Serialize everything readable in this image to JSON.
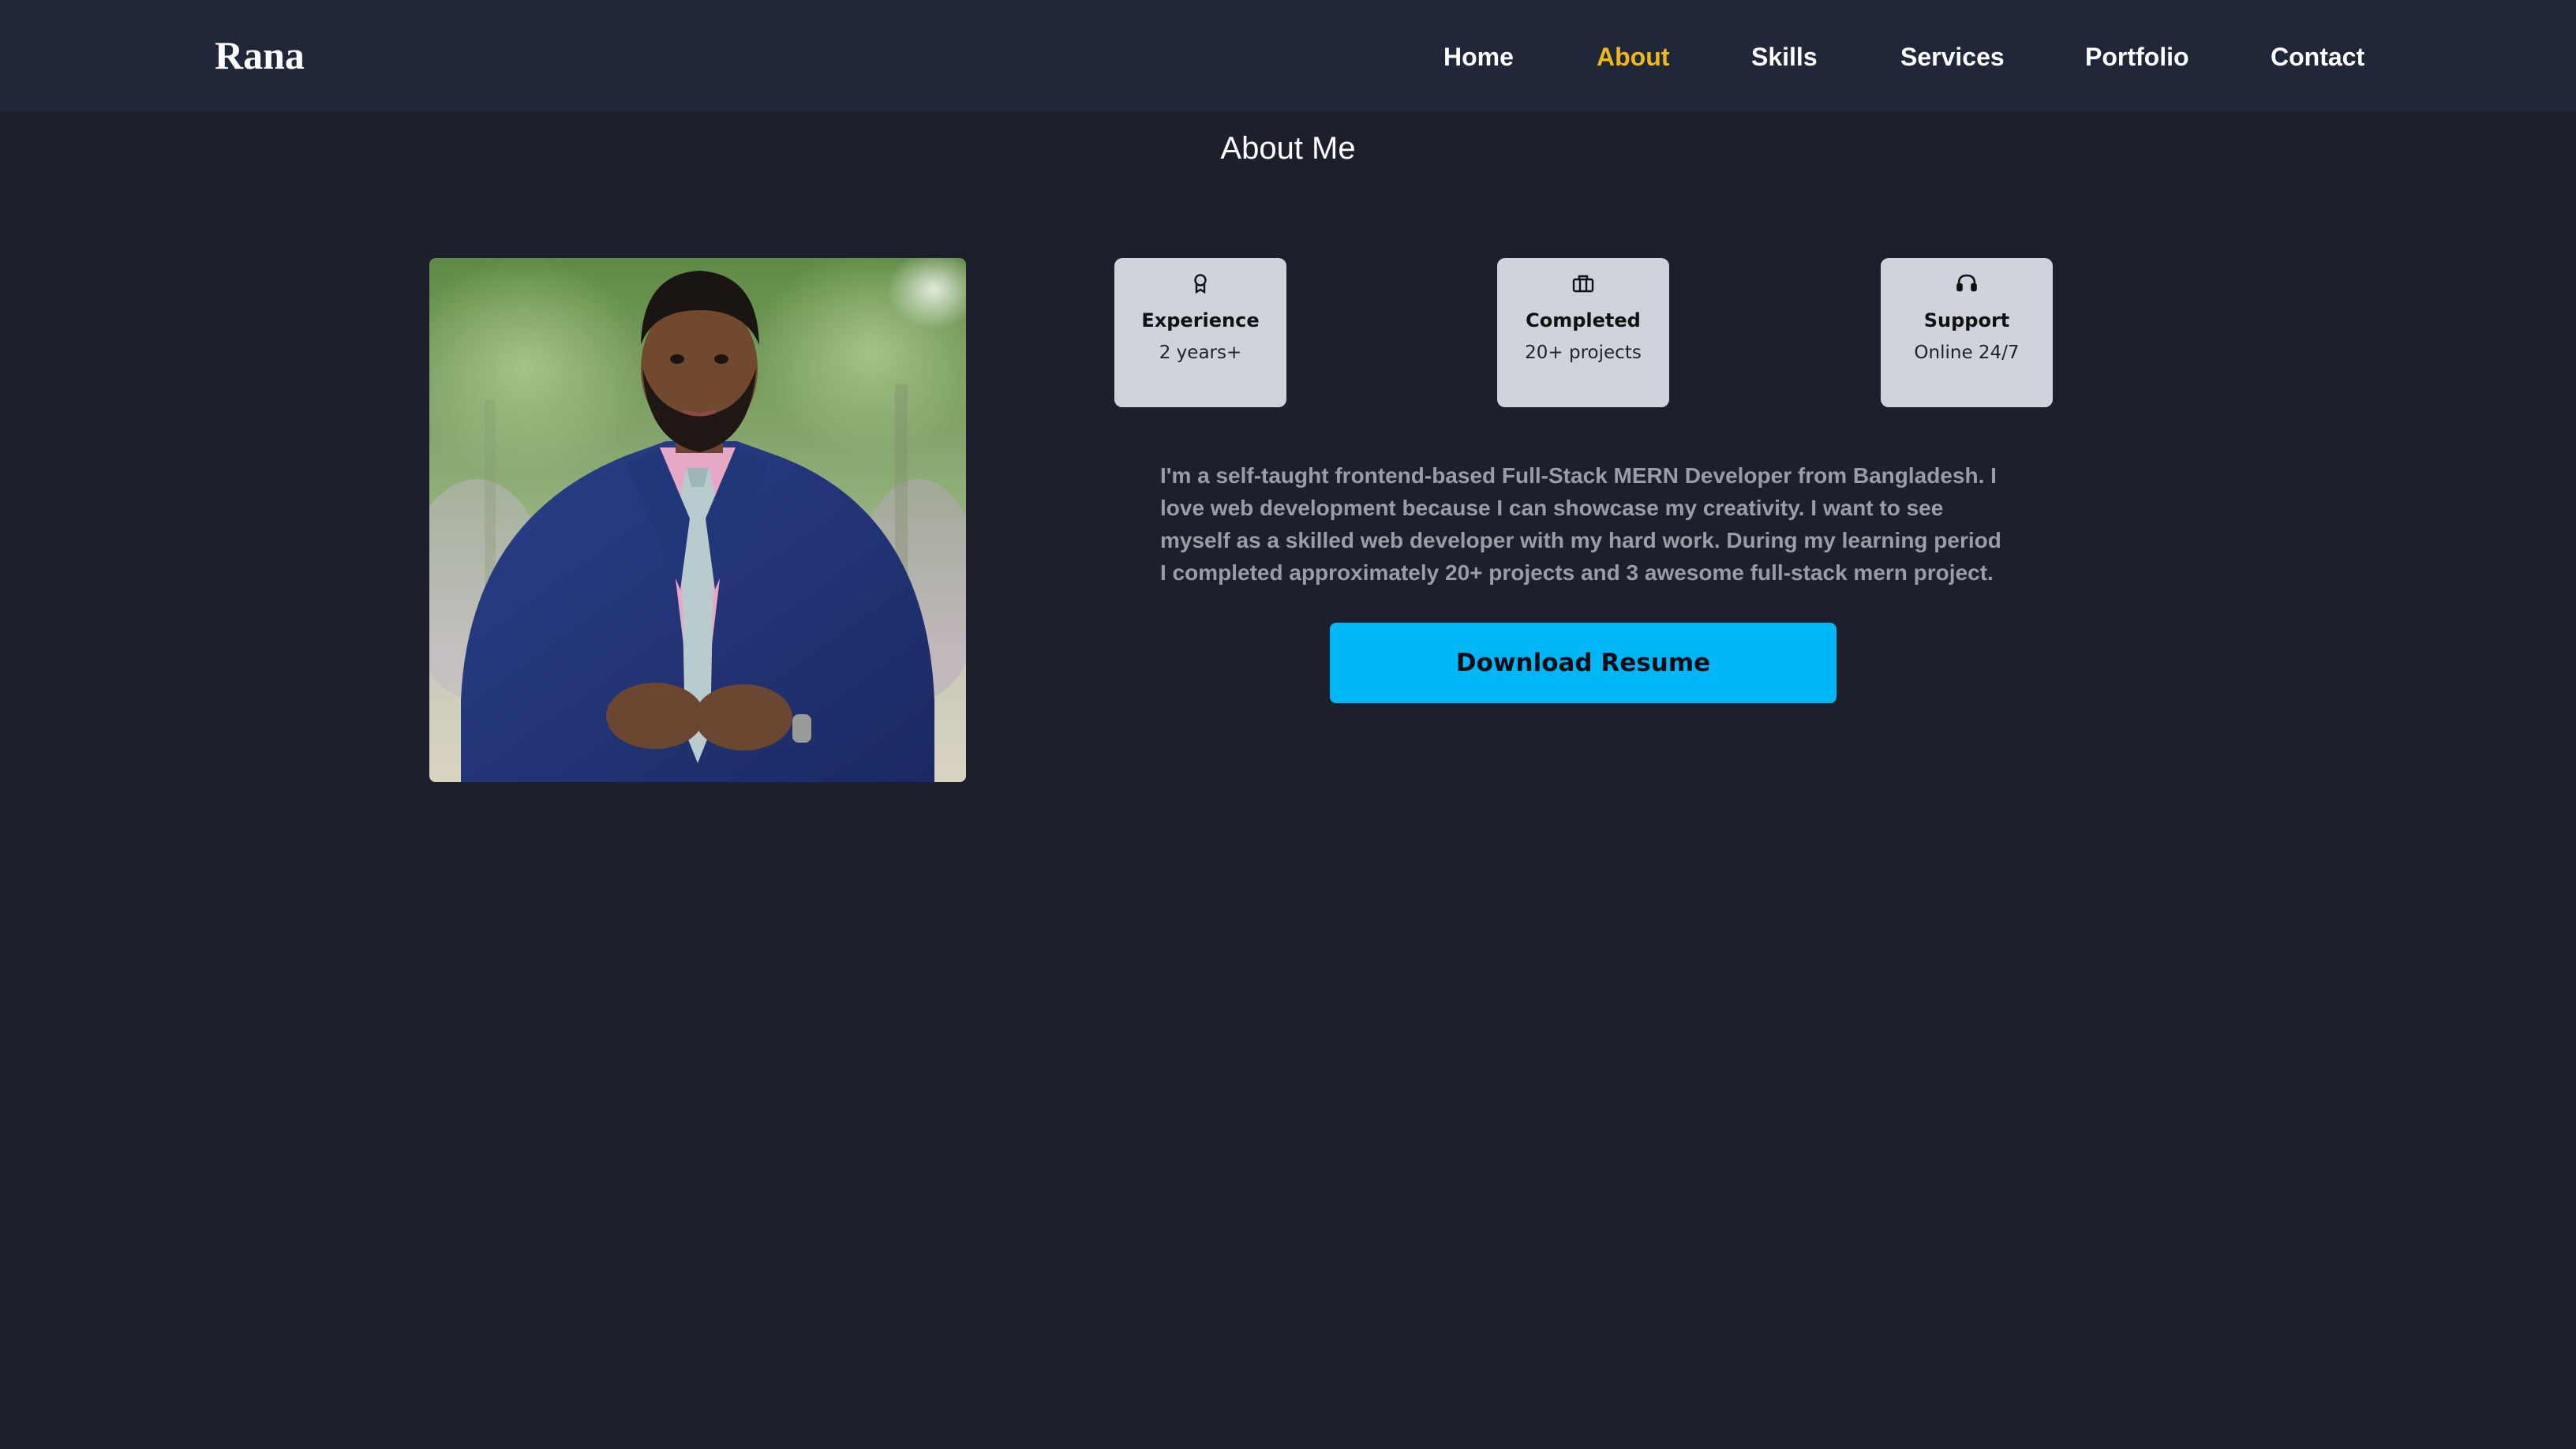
{
  "navbar": {
    "logo": "Rana",
    "links": [
      {
        "label": "Home",
        "active": false
      },
      {
        "label": "About",
        "active": true
      },
      {
        "label": "Skills",
        "active": false
      },
      {
        "label": "Services",
        "active": false
      },
      {
        "label": "Portfolio",
        "active": false
      },
      {
        "label": "Contact",
        "active": false
      }
    ]
  },
  "about": {
    "title": "About Me",
    "cards": [
      {
        "icon": "award-icon",
        "title": "Experience",
        "value": "2 years+"
      },
      {
        "icon": "briefcase-icon",
        "title": "Completed",
        "value": "20+ projects"
      },
      {
        "icon": "headset-icon",
        "title": "Support",
        "value": "Online 24/7"
      }
    ],
    "bio": "I'm a self-taught frontend-based Full-Stack MERN Developer from Bangladesh. I love web development because I can showcase my creativity. I want to see myself as a skilled web developer with my hard work. During my learning period I completed approximately 20+ projects and 3 awesome full-stack mern project.",
    "download_button": "Download Resume"
  },
  "colors": {
    "background": "#1e1f2c",
    "navbar": "#1f2738",
    "active_link": "#f0b81c",
    "card": "#cfd3db",
    "button": "#00b7f5",
    "bio_text": "#9a9ca6"
  }
}
